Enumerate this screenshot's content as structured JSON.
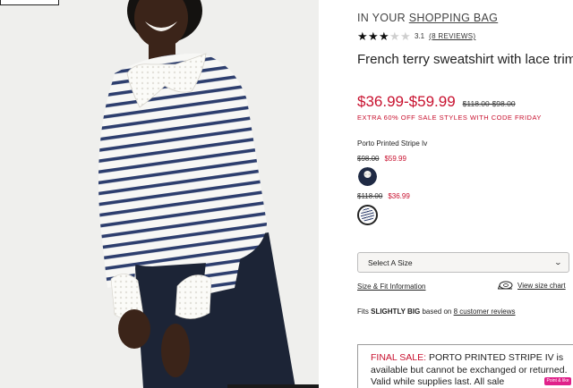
{
  "bag": {
    "prefix": "IN YOUR ",
    "link": "SHOPPING BAG"
  },
  "rating": {
    "value": "3.1",
    "stars_filled": 3,
    "stars_total": 5,
    "reviews_link": "(8 REVIEWS)"
  },
  "product": {
    "title": "French terry sweatshirt with lace trim"
  },
  "price": {
    "sale_range": "$36.99-$59.99",
    "original_range": "$118.00-$98.00",
    "promo": "EXTRA 60% OFF SALE STYLES WITH CODE FRIDAY"
  },
  "color": {
    "name": "Porto Printed Stripe Iv",
    "options": [
      {
        "was": "$98.00",
        "now": "$59.99",
        "swatch_color": "#1f2a44"
      },
      {
        "was": "$118.00",
        "now": "$36.99",
        "swatch_color": "#2d3e6e"
      }
    ]
  },
  "size_select": {
    "label": "Select A Size"
  },
  "links": {
    "fit_info": "Size & Fit Information",
    "size_chart": "View size chart"
  },
  "fit": {
    "prefix": "Fits ",
    "value": "SLIGHTLY BIG",
    "mid": " based on ",
    "reviews": "8 customer reviews"
  },
  "final_sale": {
    "label": "FINAL SALE:",
    "text": " PORTO PRINTED STRIPE IV is available but cannot be exchanged or returned. Valid while supplies last. All sale"
  },
  "badge": {
    "label": "Point & like"
  },
  "colors": {
    "sale_red": "#c8102e",
    "stripe_navy": "#2d3e6e",
    "badge_pink": "#e0218a"
  }
}
